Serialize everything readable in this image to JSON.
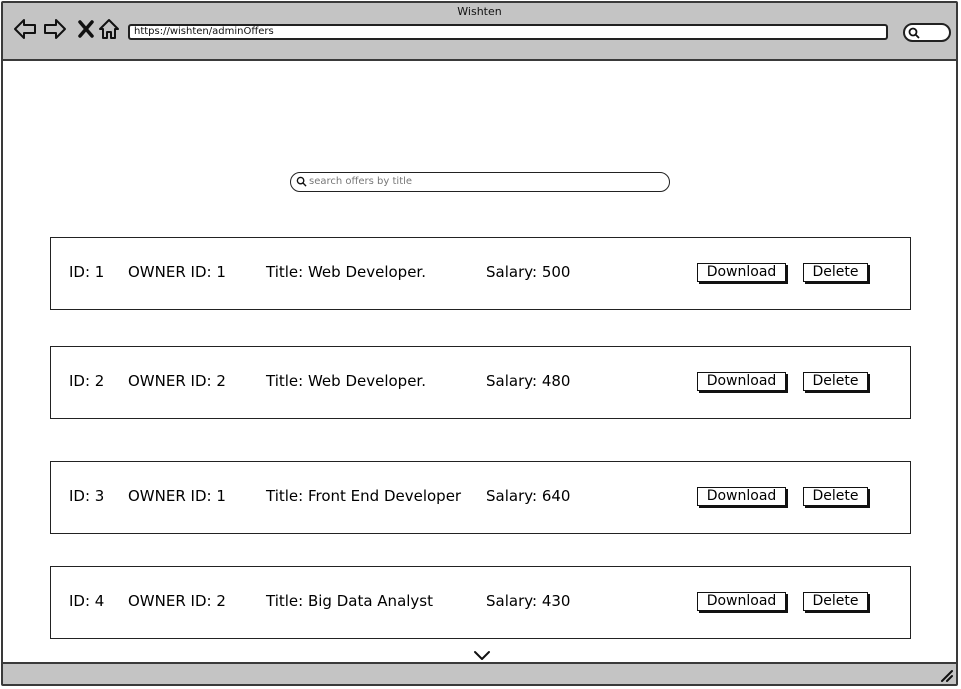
{
  "window": {
    "title": "Wishten"
  },
  "browser": {
    "url": "https://wishten/adminOffers"
  },
  "search": {
    "placeholder": "search offers by title",
    "value": ""
  },
  "actions": {
    "download_label": "Download",
    "delete_label": "Delete"
  },
  "offers": [
    {
      "id": "ID: 1",
      "owner": "OWNER ID: 1",
      "title": "Title: Web Developer.",
      "salary": "Salary: 500"
    },
    {
      "id": "ID: 2",
      "owner": "OWNER ID: 2",
      "title": "Title: Web Developer.",
      "salary": "Salary: 480"
    },
    {
      "id": "ID: 3",
      "owner": "OWNER ID: 1",
      "title": "Title: Front End Developer",
      "salary": "Salary: 640"
    },
    {
      "id": "ID: 4",
      "owner": "OWNER ID: 2",
      "title": "Title: Big Data Analyst",
      "salary": "Salary: 430"
    }
  ],
  "icons": {
    "back": "back-arrow-icon",
    "forward": "forward-arrow-icon",
    "stop": "close-icon",
    "home": "home-icon",
    "search": "search-icon",
    "scroll": "chevron-down-icon",
    "resize": "resize-grip-icon"
  }
}
